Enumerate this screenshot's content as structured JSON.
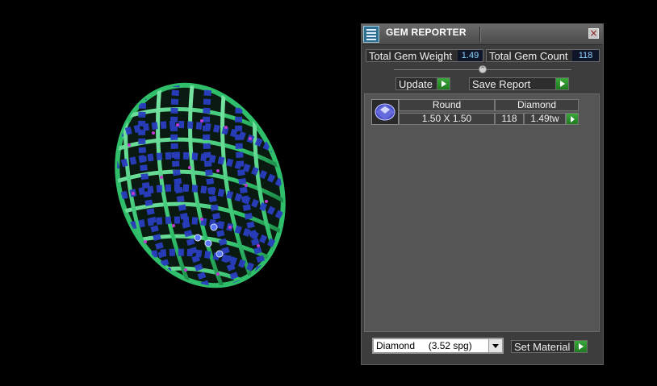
{
  "panel": {
    "title": "GEM REPORTER",
    "close_symbol": "×",
    "total_gem_weight_label": "Total Gem Weight",
    "total_gem_weight_value": "1.49",
    "total_gem_count_label": "Total Gem Count",
    "total_gem_count_value": "118",
    "update_label": "Update",
    "save_report_label": "Save Report",
    "collapse_symbol": "^"
  },
  "gem_table": {
    "rows": [
      {
        "shape": "Round",
        "material": "Diamond",
        "size": "1.50 X 1.50",
        "count": "118",
        "weight": "1.49tw"
      }
    ]
  },
  "material": {
    "selected": "Diamond     (3.52 spg)",
    "set_label": "Set Material"
  },
  "icons": {
    "title": "gem-reporter-icon",
    "close": "close-icon",
    "go": "green-arrow-icon",
    "dropdown": "chevron-down-icon",
    "gem": "round-gem-icon"
  },
  "colors": {
    "panel_bg": "#3d3d3d",
    "value_text": "#8fd4ff",
    "go_arrow": "#2e942e",
    "ring_metal": "#2fbf6a",
    "ring_gems": "#2a3fc0"
  }
}
